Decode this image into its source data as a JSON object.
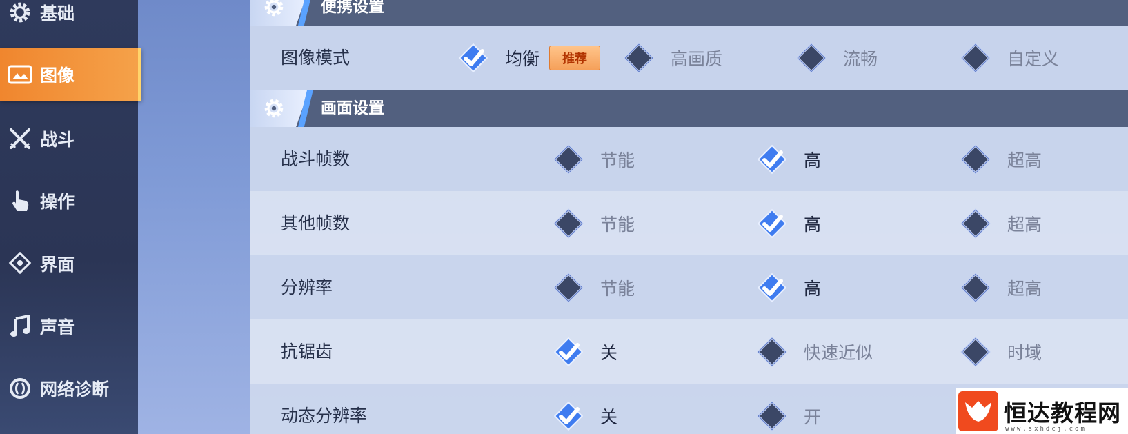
{
  "sidebar": {
    "items": [
      {
        "label": "基础",
        "icon": "gear-icon"
      },
      {
        "label": "图像",
        "icon": "image-icon",
        "active": true
      },
      {
        "label": "战斗",
        "icon": "crossed-swords-icon"
      },
      {
        "label": "操作",
        "icon": "hand-pointer-icon"
      },
      {
        "label": "界面",
        "icon": "interface-icon"
      },
      {
        "label": "声音",
        "icon": "music-note-icon"
      },
      {
        "label": "网络诊断",
        "icon": "network-icon"
      }
    ]
  },
  "sections": {
    "convenient": {
      "title": "便携设置",
      "image_mode": {
        "label": "图像模式",
        "options": [
          "均衡",
          "高画质",
          "流畅",
          "自定义"
        ],
        "recommend_badge": "推荐",
        "selected": 0
      }
    },
    "display": {
      "title": "画面设置",
      "rows": [
        {
          "label": "战斗帧数",
          "options": [
            "节能",
            "高",
            "超高"
          ],
          "selected": 1
        },
        {
          "label": "其他帧数",
          "options": [
            "节能",
            "高",
            "超高"
          ],
          "selected": 1
        },
        {
          "label": "分辨率",
          "options": [
            "节能",
            "高",
            "超高"
          ],
          "selected": 1
        },
        {
          "label": "抗锯齿",
          "options": [
            "关",
            "快速近似",
            "时域"
          ],
          "selected": 0
        },
        {
          "label": "动态分辨率",
          "options": [
            "关",
            "开"
          ],
          "selected": 0
        }
      ]
    }
  },
  "watermark": {
    "text": "恒达教程网",
    "url": "www.sxhdcj.com"
  },
  "colors": {
    "accent": "#f0862e",
    "check": "#3f7cf0",
    "header": "#52607f"
  }
}
